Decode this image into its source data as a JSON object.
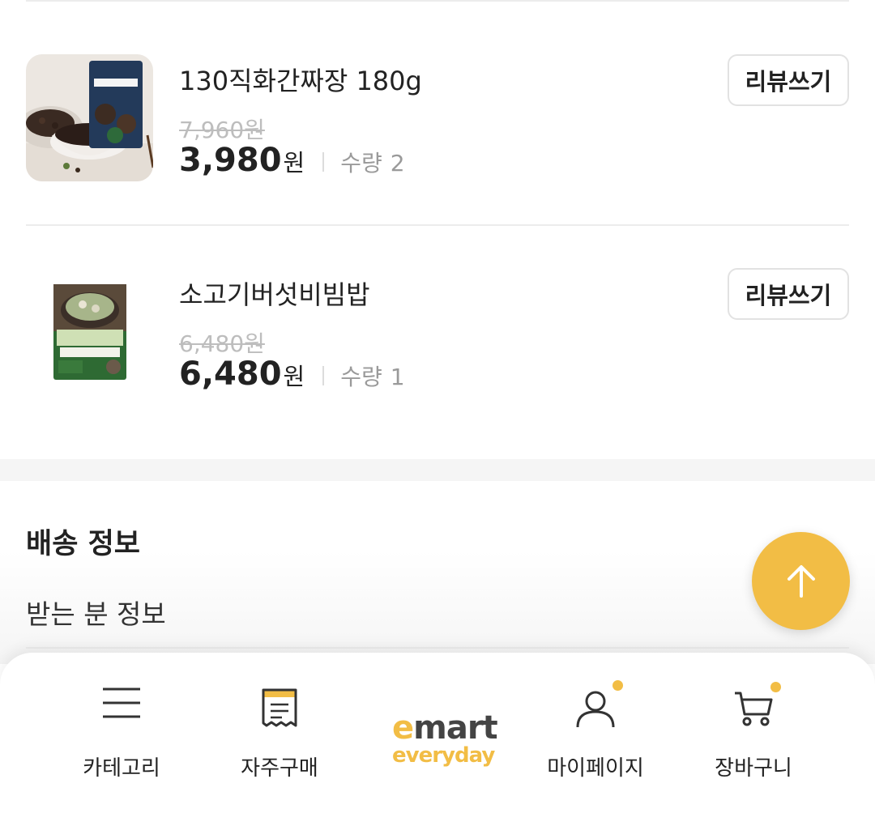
{
  "products": [
    {
      "name": "130직화간짜장 180g",
      "original_price": "7,960원",
      "price": "3,980",
      "currency": "원",
      "qty_label": "수량",
      "qty": "2",
      "review_label": "리뷰쓰기",
      "thumb_icon": "jjajang-pouch-image"
    },
    {
      "name": "소고기버섯비빔밥",
      "original_price": "6,480원",
      "price": "6,480",
      "currency": "원",
      "qty_label": "수량",
      "qty": "1",
      "review_label": "리뷰쓰기",
      "thumb_icon": "bibimbap-package-image"
    }
  ],
  "shipping": {
    "title": "배송 정보",
    "recipient_label": "받는 분 정보"
  },
  "scroll_top_icon": "arrow-up-icon",
  "bottom_nav": {
    "items": [
      {
        "label": "카테고리",
        "icon": "menu-lines-icon"
      },
      {
        "label": "자주구매",
        "icon": "receipt-icon"
      },
      {
        "label": "마이페이지",
        "icon": "user-icon",
        "badge": true
      },
      {
        "label": "장바구니",
        "icon": "cart-icon",
        "badge": true
      }
    ],
    "logo": {
      "top": "emart",
      "bottom": "everyday"
    }
  },
  "colors": {
    "accent": "#f2bd45",
    "text": "#222222",
    "muted": "#9a9a9a",
    "strike": "#bdbdbd"
  }
}
